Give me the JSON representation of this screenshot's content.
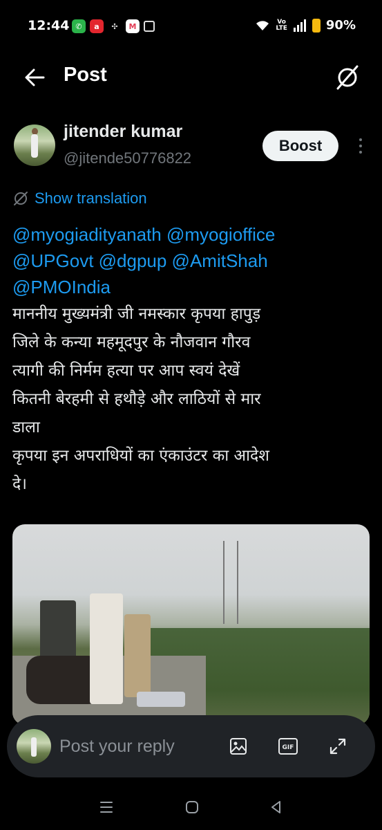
{
  "status_bar": {
    "time": "12:44",
    "volte": "Vo\nLTE",
    "battery": "90%"
  },
  "header": {
    "title": "Post"
  },
  "post": {
    "author_name": "jitender kumar",
    "author_handle": "@jitende50776822",
    "boost_label": "Boost",
    "translation_label": "Show translation",
    "mentions_lines": [
      "@myogiadityanath @myogioffice",
      "@UPGovt @dgpup @AmitShah",
      "@PMOIndia"
    ],
    "body_lines": [
      "माननीय मुख्यमंत्री जी नमस्कार कृपया हापुड़",
      "जिले के कन्या महमूदपुर के नौजवान गौरव",
      "त्यागी की निर्मम हत्या पर आप स्वयं देखें",
      "कितनी बेरहमी से हथौड़े और लाठियों से मार",
      "डाला",
      "कृपया इन अपराधियों का एंकाउंटर का आदेश",
      "दे।"
    ]
  },
  "reply": {
    "placeholder": "Post your reply"
  },
  "colors": {
    "accent": "#1d9bf0",
    "background": "#000000",
    "battery": "#f5b90f"
  },
  "icons": [
    "back-arrow-icon",
    "grok-icon",
    "translate-icon",
    "image-icon",
    "gif-icon",
    "expand-icon",
    "recents-icon",
    "home-icon",
    "back-icon"
  ]
}
